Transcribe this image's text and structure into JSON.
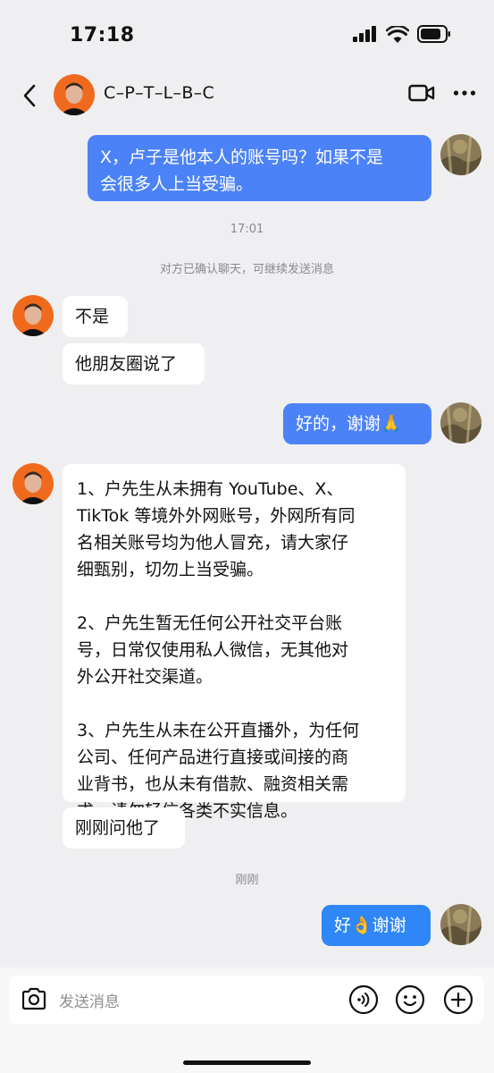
{
  "status": {
    "time": "17:18"
  },
  "header": {
    "title": "C–P–T–L–B–C"
  },
  "messages": {
    "m1": "X，卢子是他本人的账号吗？如果不是\n会很多人上当受骗。",
    "t1": "17:01",
    "sys1": "对方已确认聊天，可继续发送消息",
    "m2": "不是",
    "m3": "他朋友圈说了",
    "m4": "好的，谢谢🙏",
    "m5": "1、户先生从未拥有 YouTube、X、\nTikTok 等境外外网账号，外网所有同\n名相关账号均为他人冒充，请大家仔\n细甄别，切勿上当受骗。\n\n2、户先生暂无任何公开社交平台账\n号，日常仅使用私人微信，无其他对\n外公开社交渠道。\n\n3、户先生从未在公开直播外，为任何\n公司、任何产品进行直接或间接的商\n业背书，也从未有借款、融资相关需\n求，请勿轻信各类不实信息。",
    "m6": "刚刚问他了",
    "t2": "刚刚",
    "m7": "好👌谢谢"
  },
  "input": {
    "placeholder": "发送消息"
  },
  "colors": {
    "my_bubble": "#4c82f7",
    "their_bubble": "#ffffff",
    "background": "#efeff1"
  }
}
